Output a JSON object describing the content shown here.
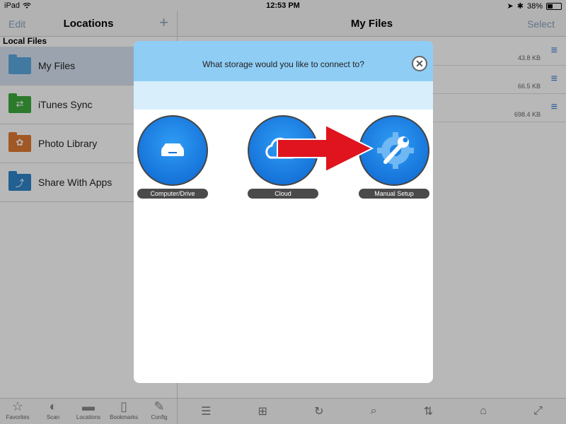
{
  "status_bar": {
    "device": "iPad",
    "time": "12:53 PM",
    "battery": "38%"
  },
  "left_pane": {
    "edit_label": "Edit",
    "title": "Locations",
    "add_label": "+",
    "section": "Local Files",
    "items": [
      {
        "label": "My Files",
        "icon": "folder-icon",
        "color": "#5aa8e0"
      },
      {
        "label": "iTunes Sync",
        "icon": "sync-icon",
        "color": "#3daa3d"
      },
      {
        "label": "Photo Library",
        "icon": "photo-library-icon",
        "color": "#e07b32"
      },
      {
        "label": "Share With Apps",
        "icon": "share-icon",
        "color": "#2f86c9"
      }
    ],
    "tabs": [
      {
        "label": "Favorites",
        "icon": "star-icon"
      },
      {
        "label": "Scan",
        "icon": "scan-icon"
      },
      {
        "label": "Locations",
        "icon": "folder-icon"
      },
      {
        "label": "Bookmarks",
        "icon": "bookmark-icon"
      },
      {
        "label": "Config",
        "icon": "wrench-icon"
      }
    ]
  },
  "right_pane": {
    "title": "My Files",
    "select_label": "Select",
    "files": [
      {
        "size": "43.8 KB"
      },
      {
        "size": "66.5 KB"
      },
      {
        "size": "698.4 KB"
      }
    ],
    "toolbar": [
      "list-icon",
      "new-folder-icon",
      "refresh-icon",
      "search-icon",
      "sort-icon",
      "home-icon",
      "expand-icon"
    ]
  },
  "dialog": {
    "question": "What storage would you like to connect to?",
    "options": [
      {
        "label": "Computer/Drive",
        "icon": "drive-icon"
      },
      {
        "label": "Cloud",
        "icon": "cloud-icon"
      },
      {
        "label": "Manual Setup",
        "icon": "gear-wrench-icon"
      }
    ],
    "accent": "#8fcdf5",
    "arrow_color": "#e0141e"
  }
}
